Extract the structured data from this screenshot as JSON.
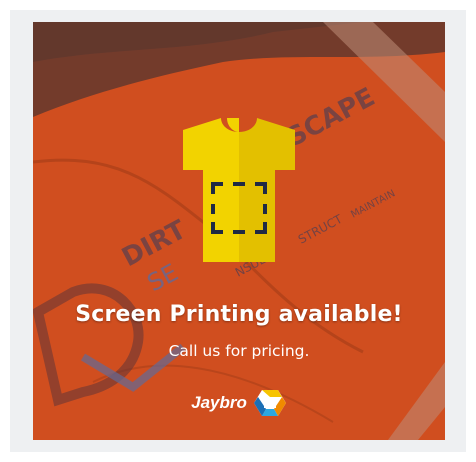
{
  "photo": {
    "garment_print": {
      "line1": "DIRT",
      "line1b": "SCAPE",
      "line2": "SE",
      "line3": "NSULT",
      "line4": "STRUCT",
      "line5": "MAINTAIN"
    }
  },
  "overlay": {
    "icon": "t-shirt-icon",
    "headline": "Screen Printing available!",
    "subline": "Call us for pricing."
  },
  "brand": {
    "name": "Jaybro",
    "logo": "jaybro-logo-icon"
  },
  "colors": {
    "overlay_orange": "#c94a1f",
    "shirt_yellow": "#f2d300",
    "shirt_shade": "#e3c000",
    "icon_navy": "#1f2a44",
    "text_white": "#ffffff"
  }
}
